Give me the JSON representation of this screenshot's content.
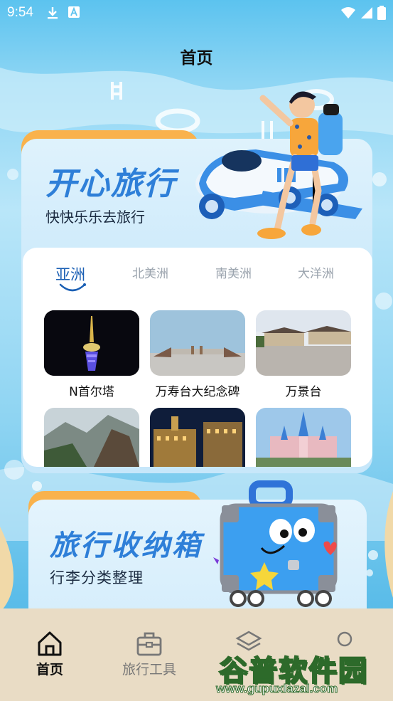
{
  "status_bar": {
    "time": "9:54",
    "icons": [
      "download-icon",
      "a-box-icon",
      "wifi-icon",
      "signal-icon",
      "battery-icon"
    ]
  },
  "header": {
    "title": "首页"
  },
  "travel_card": {
    "title": "开心旅行",
    "subtitle": "快快乐乐去旅行",
    "tabs": [
      {
        "label": "亚洲",
        "active": true
      },
      {
        "label": "北美洲",
        "active": false
      },
      {
        "label": "南美洲",
        "active": false
      },
      {
        "label": "大洋洲",
        "active": false
      }
    ],
    "places": [
      {
        "name": "N首尔塔"
      },
      {
        "name": "万寿台大纪念碑"
      },
      {
        "name": "万景台"
      },
      {
        "name": ""
      },
      {
        "name": ""
      },
      {
        "name": ""
      }
    ]
  },
  "luggage_card": {
    "title": "旅行收纳箱",
    "subtitle": "行李分类整理"
  },
  "bottom_nav": {
    "items": [
      {
        "label": "首页",
        "active": true,
        "icon": "home-icon"
      },
      {
        "label": "旅行工具",
        "active": false,
        "icon": "toolbox-icon"
      },
      {
        "label": "",
        "active": false,
        "icon": "layers-icon"
      },
      {
        "label": "",
        "active": false,
        "icon": "profile-icon"
      }
    ]
  },
  "watermark": {
    "brand": "谷普软件园",
    "url": "www.gupuxlazal.com"
  },
  "colors": {
    "accent": "#2e7fd8",
    "tab_orange": "#f9b24c",
    "nav_bg": "#e9dcc5",
    "active_nav": "#111111",
    "inactive_nav": "#777777"
  }
}
